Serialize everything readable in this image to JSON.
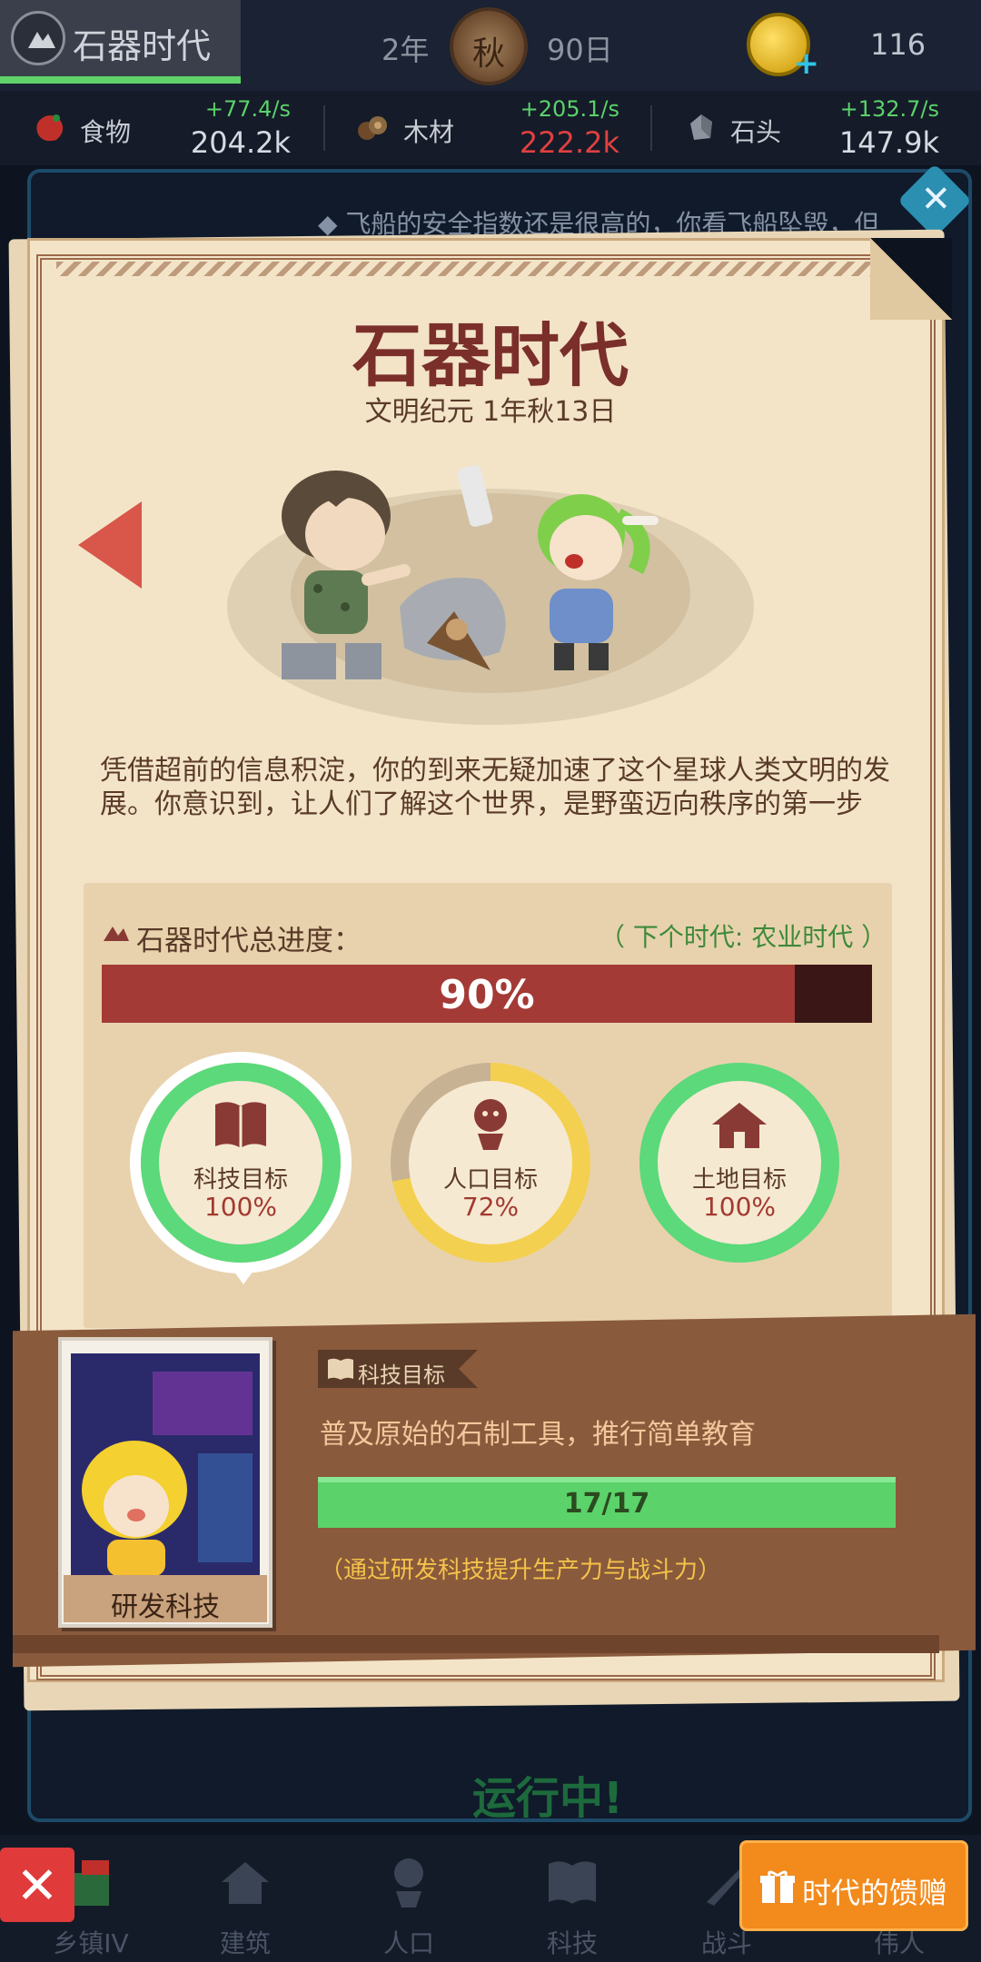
{
  "topbar": {
    "era_name": "石器时代",
    "year": "2年",
    "season": "秋",
    "day": "90日",
    "coins": "116"
  },
  "resources": [
    {
      "name": "食物",
      "rate": "+77.4/s",
      "amount": "204.2k",
      "warn": false
    },
    {
      "name": "木材",
      "rate": "+205.1/s",
      "amount": "222.2k",
      "warn": true
    },
    {
      "name": "石头",
      "rate": "+132.7/s",
      "amount": "147.9k",
      "warn": false
    }
  ],
  "background": {
    "message": "◆ 飞船的安全指数还是很高的，你看飞船坠毁，但",
    "running": "运行中!"
  },
  "card": {
    "title": "石器时代",
    "subtitle": "文明纪元 1年秋13日",
    "description": "凭借超前的信息积淀，你的到来无疑加速了这个星球人类文明的发展。你意识到，让人们了解这个世界，是野蛮迈向秩序的第一步",
    "progress_label": "石器时代总进度：",
    "next_era": "（ 下个时代: 农业时代 ）",
    "progress": 0.9,
    "progress_text": "90%",
    "goals": [
      {
        "name": "科技目标",
        "pct_text": "100%",
        "value": 1.0,
        "icon": "book-icon",
        "selected": true
      },
      {
        "name": "人口目标",
        "pct_text": "72%",
        "value": 0.72,
        "icon": "person-icon",
        "selected": false
      },
      {
        "name": "土地目标",
        "pct_text": "100%",
        "value": 1.0,
        "icon": "house-icon",
        "selected": false
      }
    ]
  },
  "tech": {
    "portrait_button": "研发科技",
    "tag": "科技目标",
    "description": "普及原始的石制工具，推行简单教育",
    "progress_text": "17/17",
    "progress": 1.0,
    "hint": "（通过研发科技提升生产力与战斗力）"
  },
  "nav": {
    "items": [
      "乡镇IV",
      "建筑",
      "人口",
      "科技",
      "战斗",
      "伟人"
    ],
    "close": "✕",
    "gift_button": "时代的馈赠"
  },
  "colors": {
    "accent_red": "#a43a36",
    "goal_green": "#5cd97a",
    "goal_yellow": "#f4d050",
    "tech_green": "#5cd26a",
    "gift_orange": "#f28a1c"
  }
}
